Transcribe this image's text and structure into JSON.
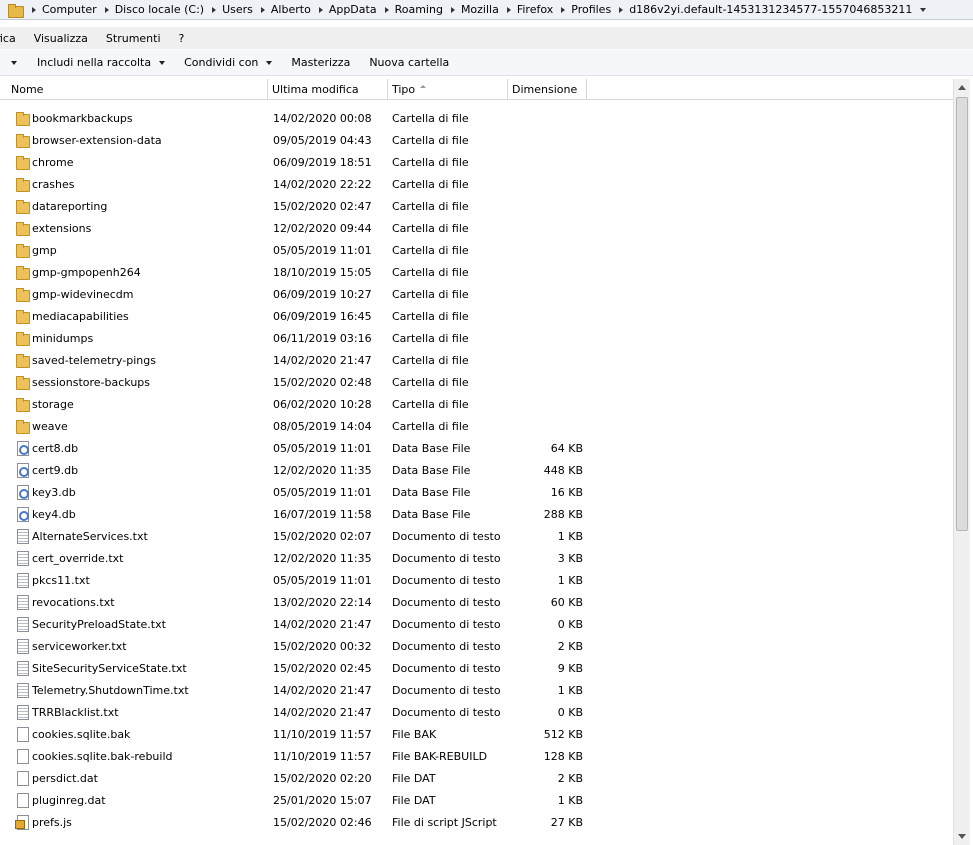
{
  "address_bar": {
    "crumbs": [
      "Computer",
      "Disco locale (C:)",
      "Users",
      "Alberto",
      "AppData",
      "Roaming",
      "Mozilla",
      "Firefox",
      "Profiles",
      "d186v2yi.default-1453131234577-1557046853211"
    ]
  },
  "menu": {
    "items": [
      "fica",
      "Visualizza",
      "Strumenti",
      "?"
    ]
  },
  "commands": {
    "include_label": "Includi nella raccolta",
    "share_label": "Condividi con",
    "burn_label": "Masterizza",
    "new_folder_label": "Nuova cartella"
  },
  "columns": {
    "name": "Nome",
    "date": "Ultima modifica",
    "type": "Tipo",
    "size": "Dimensione"
  },
  "files": [
    {
      "name": "bookmarkbackups",
      "date": "14/02/2020 00:08",
      "type": "Cartella di file",
      "size": "",
      "icon": "folder"
    },
    {
      "name": "browser-extension-data",
      "date": "09/05/2019 04:43",
      "type": "Cartella di file",
      "size": "",
      "icon": "folder"
    },
    {
      "name": "chrome",
      "date": "06/09/2019 18:51",
      "type": "Cartella di file",
      "size": "",
      "icon": "folder"
    },
    {
      "name": "crashes",
      "date": "14/02/2020 22:22",
      "type": "Cartella di file",
      "size": "",
      "icon": "folder"
    },
    {
      "name": "datareporting",
      "date": "15/02/2020 02:47",
      "type": "Cartella di file",
      "size": "",
      "icon": "folder"
    },
    {
      "name": "extensions",
      "date": "12/02/2020 09:44",
      "type": "Cartella di file",
      "size": "",
      "icon": "folder"
    },
    {
      "name": "gmp",
      "date": "05/05/2019 11:01",
      "type": "Cartella di file",
      "size": "",
      "icon": "folder"
    },
    {
      "name": "gmp-gmpopenh264",
      "date": "18/10/2019 15:05",
      "type": "Cartella di file",
      "size": "",
      "icon": "folder"
    },
    {
      "name": "gmp-widevinecdm",
      "date": "06/09/2019 10:27",
      "type": "Cartella di file",
      "size": "",
      "icon": "folder"
    },
    {
      "name": "mediacapabilities",
      "date": "06/09/2019 16:45",
      "type": "Cartella di file",
      "size": "",
      "icon": "folder"
    },
    {
      "name": "minidumps",
      "date": "06/11/2019 03:16",
      "type": "Cartella di file",
      "size": "",
      "icon": "folder"
    },
    {
      "name": "saved-telemetry-pings",
      "date": "14/02/2020 21:47",
      "type": "Cartella di file",
      "size": "",
      "icon": "folder"
    },
    {
      "name": "sessionstore-backups",
      "date": "15/02/2020 02:48",
      "type": "Cartella di file",
      "size": "",
      "icon": "folder"
    },
    {
      "name": "storage",
      "date": "06/02/2020 10:28",
      "type": "Cartella di file",
      "size": "",
      "icon": "folder"
    },
    {
      "name": "weave",
      "date": "08/05/2019 14:04",
      "type": "Cartella di file",
      "size": "",
      "icon": "folder"
    },
    {
      "name": "cert8.db",
      "date": "05/05/2019 11:01",
      "type": "Data Base File",
      "size": "64 KB",
      "icon": "db"
    },
    {
      "name": "cert9.db",
      "date": "12/02/2020 11:35",
      "type": "Data Base File",
      "size": "448 KB",
      "icon": "db"
    },
    {
      "name": "key3.db",
      "date": "05/05/2019 11:01",
      "type": "Data Base File",
      "size": "16 KB",
      "icon": "db"
    },
    {
      "name": "key4.db",
      "date": "16/07/2019 11:58",
      "type": "Data Base File",
      "size": "288 KB",
      "icon": "db"
    },
    {
      "name": "AlternateServices.txt",
      "date": "15/02/2020 02:07",
      "type": "Documento di testo",
      "size": "1 KB",
      "icon": "txt"
    },
    {
      "name": "cert_override.txt",
      "date": "12/02/2020 11:35",
      "type": "Documento di testo",
      "size": "3 KB",
      "icon": "txt"
    },
    {
      "name": "pkcs11.txt",
      "date": "05/05/2019 11:01",
      "type": "Documento di testo",
      "size": "1 KB",
      "icon": "txt"
    },
    {
      "name": "revocations.txt",
      "date": "13/02/2020 22:14",
      "type": "Documento di testo",
      "size": "60 KB",
      "icon": "txt"
    },
    {
      "name": "SecurityPreloadState.txt",
      "date": "14/02/2020 21:47",
      "type": "Documento di testo",
      "size": "0 KB",
      "icon": "txt"
    },
    {
      "name": "serviceworker.txt",
      "date": "15/02/2020 00:32",
      "type": "Documento di testo",
      "size": "2 KB",
      "icon": "txt"
    },
    {
      "name": "SiteSecurityServiceState.txt",
      "date": "15/02/2020 02:45",
      "type": "Documento di testo",
      "size": "9 KB",
      "icon": "txt"
    },
    {
      "name": "Telemetry.ShutdownTime.txt",
      "date": "14/02/2020 21:47",
      "type": "Documento di testo",
      "size": "1 KB",
      "icon": "txt"
    },
    {
      "name": "TRRBlacklist.txt",
      "date": "14/02/2020 21:47",
      "type": "Documento di testo",
      "size": "0 KB",
      "icon": "txt"
    },
    {
      "name": "cookies.sqlite.bak",
      "date": "11/10/2019 11:57",
      "type": "File BAK",
      "size": "512 KB",
      "icon": "file"
    },
    {
      "name": "cookies.sqlite.bak-rebuild",
      "date": "11/10/2019 11:57",
      "type": "File BAK-REBUILD",
      "size": "128 KB",
      "icon": "file"
    },
    {
      "name": "persdict.dat",
      "date": "15/02/2020 02:20",
      "type": "File DAT",
      "size": "2 KB",
      "icon": "file"
    },
    {
      "name": "pluginreg.dat",
      "date": "25/01/2020 15:07",
      "type": "File DAT",
      "size": "1 KB",
      "icon": "file"
    },
    {
      "name": "prefs.js",
      "date": "15/02/2020 02:46",
      "type": "File di script JScript",
      "size": "27 KB",
      "icon": "js"
    }
  ]
}
